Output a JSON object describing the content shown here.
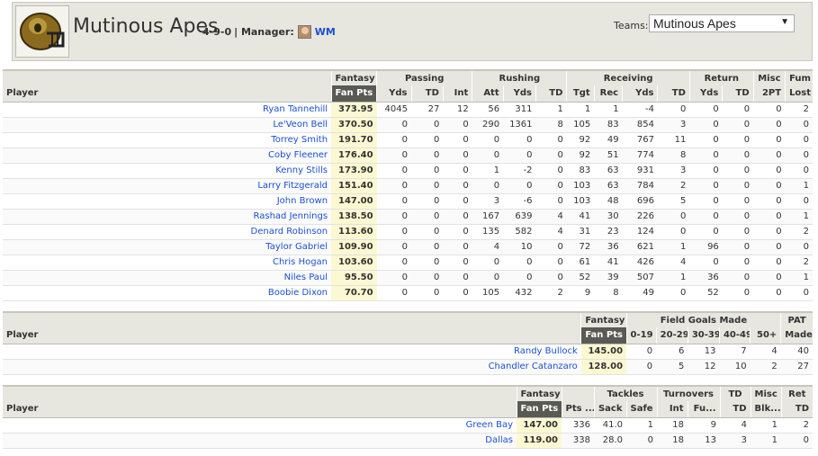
{
  "team": {
    "name": "Mutinous Apes",
    "record": "4-9-0",
    "manager_label": "| Manager:",
    "manager_name": "WM",
    "teams_label": "Teams:",
    "teams_selected": "Mutinous Apes"
  },
  "offense": {
    "groups": [
      "Fantasy",
      "Passing",
      "Rushing",
      "Receiving",
      "Return",
      "Misc",
      "Fum"
    ],
    "player_header": "Player",
    "columns": [
      "Fan Pts",
      "Yds",
      "TD",
      "Int",
      "Att",
      "Yds",
      "TD",
      "Tgt",
      "Rec",
      "Yds",
      "TD",
      "Yds",
      "TD",
      "2PT",
      "Lost"
    ],
    "rows": [
      {
        "player": "Ryan Tannehill",
        "stats": [
          "373.95",
          "4045",
          "27",
          "12",
          "56",
          "311",
          "1",
          "1",
          "1",
          "-4",
          "0",
          "0",
          "0",
          "0",
          "2"
        ]
      },
      {
        "player": "Le'Veon Bell",
        "stats": [
          "370.50",
          "0",
          "0",
          "0",
          "290",
          "1361",
          "8",
          "105",
          "83",
          "854",
          "3",
          "0",
          "0",
          "0",
          "0"
        ]
      },
      {
        "player": "Torrey Smith",
        "stats": [
          "191.70",
          "0",
          "0",
          "0",
          "0",
          "0",
          "0",
          "92",
          "49",
          "767",
          "11",
          "0",
          "0",
          "0",
          "0"
        ]
      },
      {
        "player": "Coby Fleener",
        "stats": [
          "176.40",
          "0",
          "0",
          "0",
          "0",
          "0",
          "0",
          "92",
          "51",
          "774",
          "8",
          "0",
          "0",
          "0",
          "0"
        ]
      },
      {
        "player": "Kenny Stills",
        "stats": [
          "173.90",
          "0",
          "0",
          "0",
          "1",
          "-2",
          "0",
          "83",
          "63",
          "931",
          "3",
          "0",
          "0",
          "0",
          "0"
        ]
      },
      {
        "player": "Larry Fitzgerald",
        "stats": [
          "151.40",
          "0",
          "0",
          "0",
          "0",
          "0",
          "0",
          "103",
          "63",
          "784",
          "2",
          "0",
          "0",
          "0",
          "1"
        ]
      },
      {
        "player": "John Brown",
        "stats": [
          "147.00",
          "0",
          "0",
          "0",
          "3",
          "-6",
          "0",
          "103",
          "48",
          "696",
          "5",
          "0",
          "0",
          "0",
          "0"
        ]
      },
      {
        "player": "Rashad Jennings",
        "stats": [
          "138.50",
          "0",
          "0",
          "0",
          "167",
          "639",
          "4",
          "41",
          "30",
          "226",
          "0",
          "0",
          "0",
          "0",
          "1"
        ]
      },
      {
        "player": "Denard Robinson",
        "stats": [
          "113.60",
          "0",
          "0",
          "0",
          "135",
          "582",
          "4",
          "31",
          "23",
          "124",
          "0",
          "0",
          "0",
          "0",
          "2"
        ]
      },
      {
        "player": "Taylor Gabriel",
        "stats": [
          "109.90",
          "0",
          "0",
          "0",
          "4",
          "10",
          "0",
          "72",
          "36",
          "621",
          "1",
          "96",
          "0",
          "0",
          "0"
        ]
      },
      {
        "player": "Chris Hogan",
        "stats": [
          "103.60",
          "0",
          "0",
          "0",
          "0",
          "0",
          "0",
          "61",
          "41",
          "426",
          "4",
          "0",
          "0",
          "0",
          "2"
        ]
      },
      {
        "player": "Niles Paul",
        "stats": [
          "95.50",
          "0",
          "0",
          "0",
          "0",
          "0",
          "0",
          "52",
          "39",
          "507",
          "1",
          "36",
          "0",
          "0",
          "1"
        ]
      },
      {
        "player": "Boobie Dixon",
        "stats": [
          "70.70",
          "0",
          "0",
          "0",
          "105",
          "432",
          "2",
          "9",
          "8",
          "49",
          "0",
          "52",
          "0",
          "0",
          "0"
        ]
      }
    ]
  },
  "kicking": {
    "groups": [
      "Fantasy",
      "Field Goals Made",
      "PAT"
    ],
    "player_header": "Player",
    "columns": [
      "Fan Pts",
      "0-19",
      "20-29",
      "30-39",
      "40-49",
      "50+",
      "Made"
    ],
    "rows": [
      {
        "player": "Randy Bullock",
        "stats": [
          "145.00",
          "0",
          "6",
          "13",
          "7",
          "4",
          "40"
        ]
      },
      {
        "player": "Chandler Catanzaro",
        "stats": [
          "128.00",
          "0",
          "5",
          "12",
          "10",
          "2",
          "27"
        ]
      }
    ]
  },
  "defense": {
    "groups": [
      "Fantasy",
      "",
      "Tackles",
      "Turnovers",
      "TD",
      "Misc",
      "Ret"
    ],
    "player_header": "Player",
    "columns": [
      "Fan Pts",
      "Pts ...",
      "Sack",
      "Safe",
      "Int",
      "Fu...",
      "TD",
      "Blk...",
      "TD"
    ],
    "rows": [
      {
        "player": "Green Bay",
        "stats": [
          "147.00",
          "336",
          "41.0",
          "1",
          "18",
          "9",
          "4",
          "1",
          "2"
        ]
      },
      {
        "player": "Dallas",
        "stats": [
          "119.00",
          "338",
          "28.0",
          "0",
          "18",
          "13",
          "3",
          "1",
          "0"
        ]
      }
    ]
  }
}
